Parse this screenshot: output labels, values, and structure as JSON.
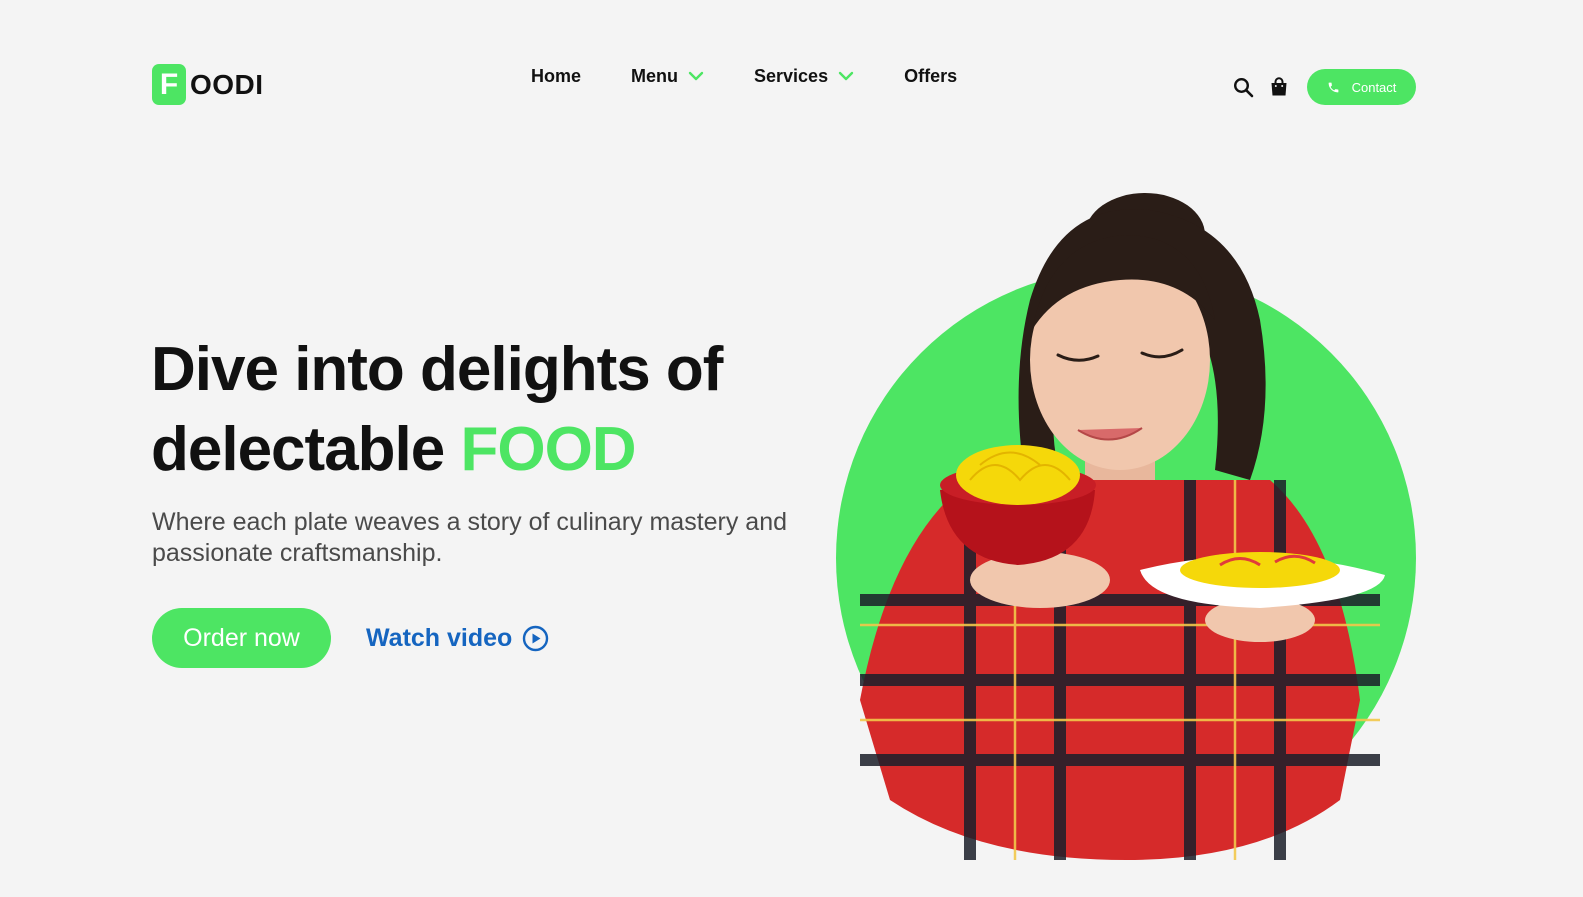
{
  "brand": {
    "mark": "F",
    "name": "OODI",
    "color": "#4de563"
  },
  "nav": {
    "items": [
      {
        "label": "Home",
        "has_dropdown": false
      },
      {
        "label": "Menu",
        "has_dropdown": true
      },
      {
        "label": "Services",
        "has_dropdown": true
      },
      {
        "label": "Offers",
        "has_dropdown": false
      }
    ]
  },
  "header": {
    "icons": [
      "search-icon",
      "shopping-bag-icon"
    ],
    "contact_label": "Contact",
    "contact_icon": "phone-icon"
  },
  "hero": {
    "title_line1": "Dive into delights of",
    "title_line2": "delectable ",
    "title_accent": "FOOD",
    "subtitle": "Where each plate weaves a story of culinary mastery and passionate craftsmanship.",
    "order_label": "Order now",
    "watch_label": "Watch video",
    "watch_icon": "play-circle-icon"
  },
  "colors": {
    "accent": "#4de563",
    "link": "#1565c0",
    "text": "#111111",
    "muted": "#4a4a4a",
    "background": "#f4f4f4"
  }
}
